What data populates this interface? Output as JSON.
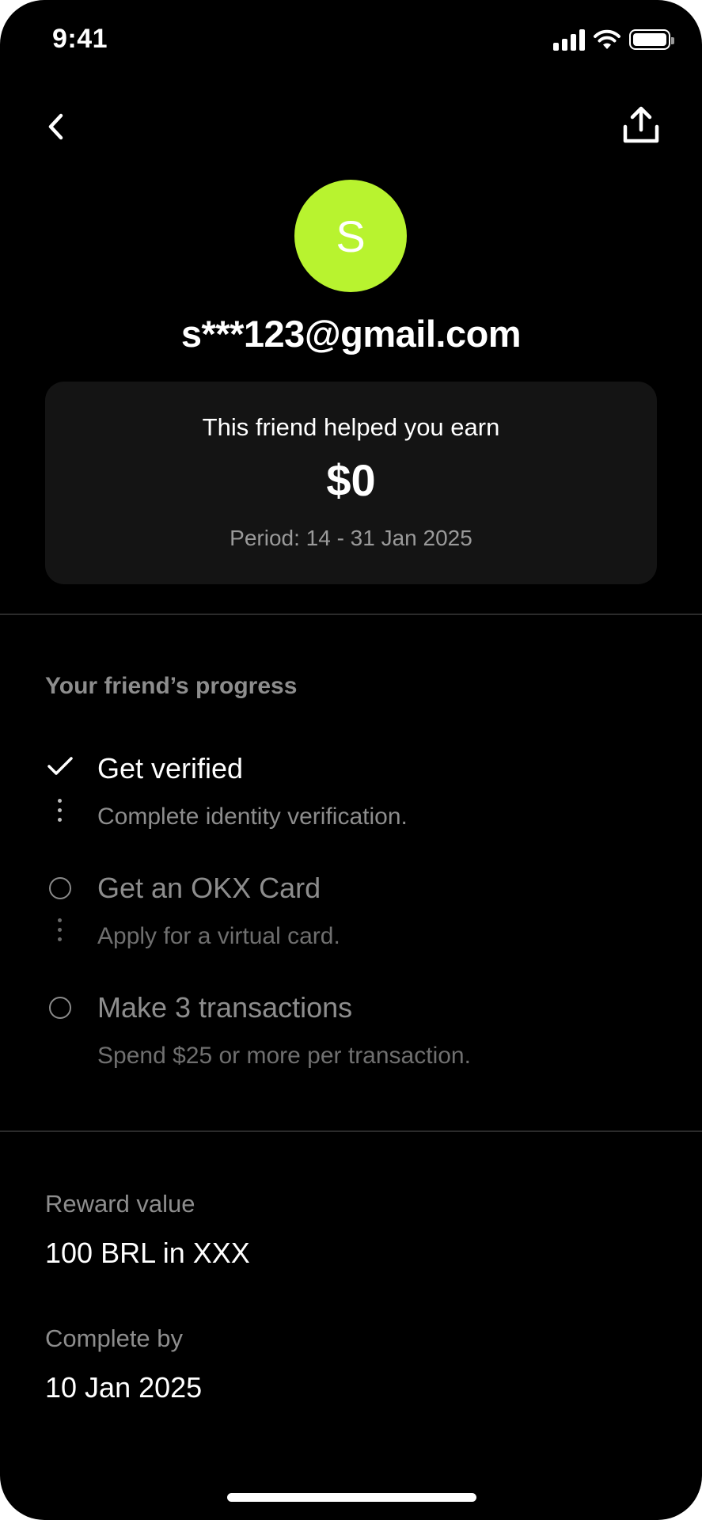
{
  "status_bar": {
    "time": "9:41"
  },
  "header": {
    "back_icon": "chevron-left-icon",
    "share_icon": "share-upload-icon"
  },
  "profile": {
    "avatar_letter": "S",
    "avatar_color": "#B8F32F",
    "email": "s***123@gmail.com"
  },
  "earnings": {
    "label": "This friend helped you earn",
    "amount": "$0",
    "period": "Period: 14 - 31 Jan 2025"
  },
  "progress": {
    "title": "Your friend’s progress",
    "steps": [
      {
        "title": "Get verified",
        "description": "Complete identity verification.",
        "status": "completed"
      },
      {
        "title": "Get an OKX Card",
        "description": "Apply for a virtual card.",
        "status": "pending"
      },
      {
        "title": "Make 3 transactions",
        "description": "Spend $25 or more per transaction.",
        "status": "pending"
      }
    ]
  },
  "reward": {
    "value_label": "Reward value",
    "value": "100 BRL in XXX",
    "complete_by_label": "Complete by",
    "complete_by": "10 Jan 2025"
  },
  "colors": {
    "background": "#000000",
    "card": "#141414",
    "accent": "#B8F32F",
    "muted_text": "#8D8D8D"
  }
}
